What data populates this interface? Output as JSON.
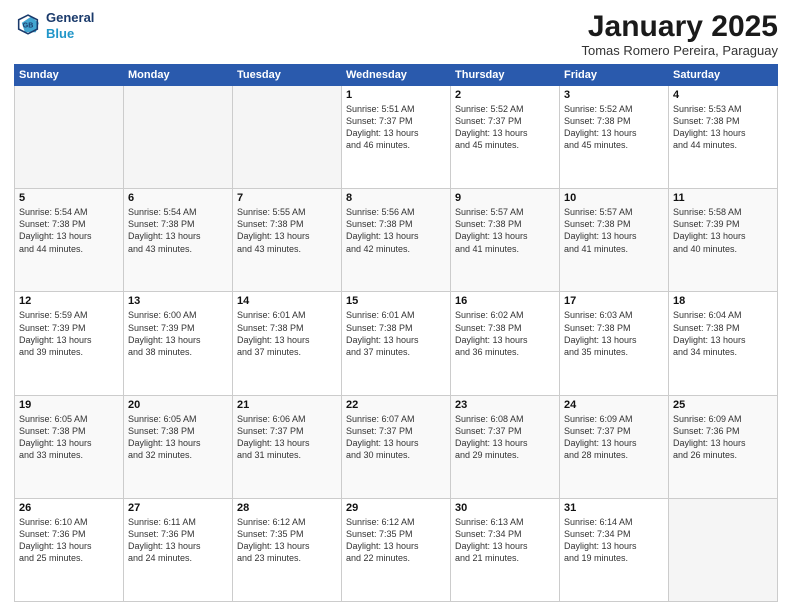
{
  "logo": {
    "line1": "General",
    "line2": "Blue"
  },
  "title": "January 2025",
  "subtitle": "Tomas Romero Pereira, Paraguay",
  "headers": [
    "Sunday",
    "Monday",
    "Tuesday",
    "Wednesday",
    "Thursday",
    "Friday",
    "Saturday"
  ],
  "weeks": [
    [
      {
        "day": "",
        "info": ""
      },
      {
        "day": "",
        "info": ""
      },
      {
        "day": "",
        "info": ""
      },
      {
        "day": "1",
        "info": "Sunrise: 5:51 AM\nSunset: 7:37 PM\nDaylight: 13 hours\nand 46 minutes."
      },
      {
        "day": "2",
        "info": "Sunrise: 5:52 AM\nSunset: 7:37 PM\nDaylight: 13 hours\nand 45 minutes."
      },
      {
        "day": "3",
        "info": "Sunrise: 5:52 AM\nSunset: 7:38 PM\nDaylight: 13 hours\nand 45 minutes."
      },
      {
        "day": "4",
        "info": "Sunrise: 5:53 AM\nSunset: 7:38 PM\nDaylight: 13 hours\nand 44 minutes."
      }
    ],
    [
      {
        "day": "5",
        "info": "Sunrise: 5:54 AM\nSunset: 7:38 PM\nDaylight: 13 hours\nand 44 minutes."
      },
      {
        "day": "6",
        "info": "Sunrise: 5:54 AM\nSunset: 7:38 PM\nDaylight: 13 hours\nand 43 minutes."
      },
      {
        "day": "7",
        "info": "Sunrise: 5:55 AM\nSunset: 7:38 PM\nDaylight: 13 hours\nand 43 minutes."
      },
      {
        "day": "8",
        "info": "Sunrise: 5:56 AM\nSunset: 7:38 PM\nDaylight: 13 hours\nand 42 minutes."
      },
      {
        "day": "9",
        "info": "Sunrise: 5:57 AM\nSunset: 7:38 PM\nDaylight: 13 hours\nand 41 minutes."
      },
      {
        "day": "10",
        "info": "Sunrise: 5:57 AM\nSunset: 7:38 PM\nDaylight: 13 hours\nand 41 minutes."
      },
      {
        "day": "11",
        "info": "Sunrise: 5:58 AM\nSunset: 7:39 PM\nDaylight: 13 hours\nand 40 minutes."
      }
    ],
    [
      {
        "day": "12",
        "info": "Sunrise: 5:59 AM\nSunset: 7:39 PM\nDaylight: 13 hours\nand 39 minutes."
      },
      {
        "day": "13",
        "info": "Sunrise: 6:00 AM\nSunset: 7:39 PM\nDaylight: 13 hours\nand 38 minutes."
      },
      {
        "day": "14",
        "info": "Sunrise: 6:01 AM\nSunset: 7:38 PM\nDaylight: 13 hours\nand 37 minutes."
      },
      {
        "day": "15",
        "info": "Sunrise: 6:01 AM\nSunset: 7:38 PM\nDaylight: 13 hours\nand 37 minutes."
      },
      {
        "day": "16",
        "info": "Sunrise: 6:02 AM\nSunset: 7:38 PM\nDaylight: 13 hours\nand 36 minutes."
      },
      {
        "day": "17",
        "info": "Sunrise: 6:03 AM\nSunset: 7:38 PM\nDaylight: 13 hours\nand 35 minutes."
      },
      {
        "day": "18",
        "info": "Sunrise: 6:04 AM\nSunset: 7:38 PM\nDaylight: 13 hours\nand 34 minutes."
      }
    ],
    [
      {
        "day": "19",
        "info": "Sunrise: 6:05 AM\nSunset: 7:38 PM\nDaylight: 13 hours\nand 33 minutes."
      },
      {
        "day": "20",
        "info": "Sunrise: 6:05 AM\nSunset: 7:38 PM\nDaylight: 13 hours\nand 32 minutes."
      },
      {
        "day": "21",
        "info": "Sunrise: 6:06 AM\nSunset: 7:37 PM\nDaylight: 13 hours\nand 31 minutes."
      },
      {
        "day": "22",
        "info": "Sunrise: 6:07 AM\nSunset: 7:37 PM\nDaylight: 13 hours\nand 30 minutes."
      },
      {
        "day": "23",
        "info": "Sunrise: 6:08 AM\nSunset: 7:37 PM\nDaylight: 13 hours\nand 29 minutes."
      },
      {
        "day": "24",
        "info": "Sunrise: 6:09 AM\nSunset: 7:37 PM\nDaylight: 13 hours\nand 28 minutes."
      },
      {
        "day": "25",
        "info": "Sunrise: 6:09 AM\nSunset: 7:36 PM\nDaylight: 13 hours\nand 26 minutes."
      }
    ],
    [
      {
        "day": "26",
        "info": "Sunrise: 6:10 AM\nSunset: 7:36 PM\nDaylight: 13 hours\nand 25 minutes."
      },
      {
        "day": "27",
        "info": "Sunrise: 6:11 AM\nSunset: 7:36 PM\nDaylight: 13 hours\nand 24 minutes."
      },
      {
        "day": "28",
        "info": "Sunrise: 6:12 AM\nSunset: 7:35 PM\nDaylight: 13 hours\nand 23 minutes."
      },
      {
        "day": "29",
        "info": "Sunrise: 6:12 AM\nSunset: 7:35 PM\nDaylight: 13 hours\nand 22 minutes."
      },
      {
        "day": "30",
        "info": "Sunrise: 6:13 AM\nSunset: 7:34 PM\nDaylight: 13 hours\nand 21 minutes."
      },
      {
        "day": "31",
        "info": "Sunrise: 6:14 AM\nSunset: 7:34 PM\nDaylight: 13 hours\nand 19 minutes."
      },
      {
        "day": "",
        "info": ""
      }
    ]
  ]
}
